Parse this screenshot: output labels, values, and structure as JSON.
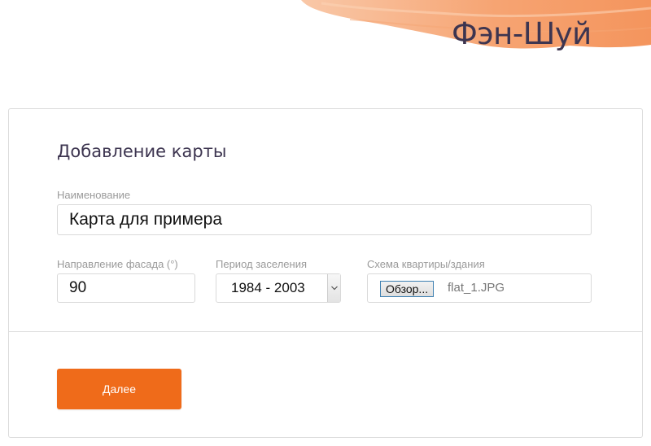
{
  "header": {
    "logo_text": "Фэн-Шуй",
    "accent_color": "#f27a35",
    "logo_color": "#3d3550"
  },
  "form": {
    "title": "Добавление карты",
    "name": {
      "label": "Наименование",
      "value": "Карта для примера"
    },
    "facade": {
      "label": "Направление фасада (°)",
      "value": "90"
    },
    "period": {
      "label": "Период заселения",
      "selected": "1984 - 2003"
    },
    "scheme": {
      "label": "Схема квартиры/здания",
      "browse_label": "Обзор...",
      "file_name": "flat_1.JPG"
    },
    "submit_label": "Далее",
    "submit_color": "#ef6b1a"
  }
}
